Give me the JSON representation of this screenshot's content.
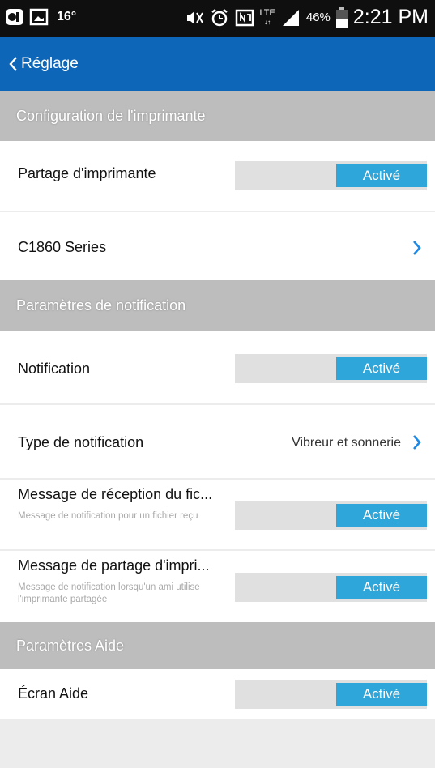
{
  "status_bar": {
    "temperature": "16°",
    "battery_percent": "46%",
    "time": "2:21 PM",
    "network": "LTE",
    "icons": [
      "ui-app-icon",
      "image-icon",
      "mute-icon",
      "alarm-icon",
      "nfc-icon",
      "lte-icon",
      "signal-icon",
      "battery-icon"
    ]
  },
  "app_bar": {
    "title": "Réglage",
    "color": "#0e66b8"
  },
  "sections": [
    {
      "title": "Configuration de l'imprimante"
    },
    {
      "title": "Paramètres de notification"
    },
    {
      "title": "Paramètres Aide"
    }
  ],
  "rows": {
    "printer_sharing": {
      "label": "Partage d'imprimante",
      "state": "Activé"
    },
    "printer": {
      "label": "C1860 Series"
    },
    "notification": {
      "label": "Notification",
      "state": "Activé"
    },
    "notification_type": {
      "label": "Type de notification",
      "value": "Vibreur et sonnerie"
    },
    "file_received": {
      "label": "Message de réception du fic...",
      "sub": "Message de notification pour un fichier reçu",
      "state": "Activé"
    },
    "printer_share_msg": {
      "label": "Message de partage d'impri...",
      "sub": "Message de notification lorsqu'un ami utilise l'imprimante partagée",
      "state": "Activé"
    },
    "help_screen": {
      "label": "Écran Aide",
      "state": "Activé"
    }
  },
  "colors": {
    "toggle_on": "#2ea6da",
    "section_bg": "#bdbdbd",
    "chevron": "#1e88e5"
  }
}
